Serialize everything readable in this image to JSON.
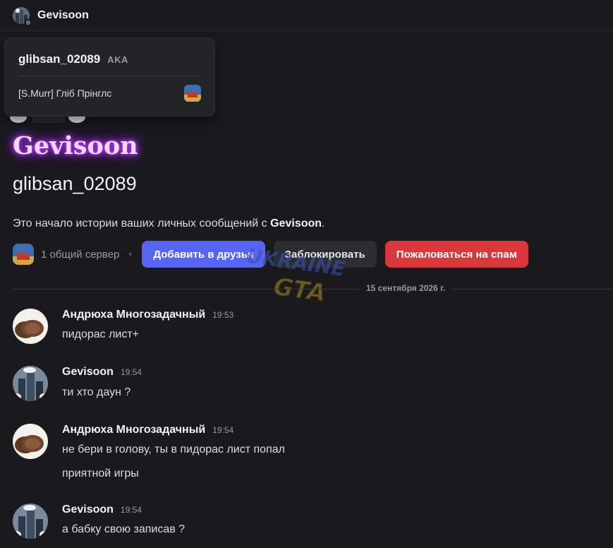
{
  "header": {
    "title": "Gevisoon"
  },
  "aka": {
    "username": "glibsan_02089",
    "tag": "AKA",
    "server_nick": "[S.Murr] Гліб Прінглс"
  },
  "profile": {
    "display_name": "Gevisoon",
    "username": "glibsan_02089",
    "intro_prefix": "Это начало истории ваших личных сообщений с ",
    "intro_name": "Gevisoon",
    "intro_suffix": "."
  },
  "actions": {
    "mutual_servers": "1 общий сервер",
    "add_friend": "Добавить в друзья",
    "block": "Заблокировать",
    "report_spam": "Пожаловаться на спам"
  },
  "date_divider": "15 сентября 2026 г.",
  "messages": [
    {
      "author": "Андрюха Многозадачный",
      "time": "19:53",
      "lines": [
        "пидорас лист+"
      ],
      "avatar": "bread-avatar"
    },
    {
      "author": "Gevisoon",
      "time": "19:54",
      "lines": [
        "ти хто даун ?"
      ],
      "avatar": "city-avatar"
    },
    {
      "author": "Андрюха Многозадачный",
      "time": "19:54",
      "lines": [
        "не бери в голову, ты в пидорас лист попал",
        "приятной игры"
      ],
      "avatar": "bread-avatar"
    },
    {
      "author": "Gevisoon",
      "time": "19:54",
      "lines": [
        "а бабку свою записав ?"
      ],
      "avatar": "city-avatar"
    }
  ],
  "colors": {
    "background": "#1a1a1e",
    "blurple": "#5865f2",
    "danger": "#da373c",
    "display_name_glow": "#a020f0"
  }
}
